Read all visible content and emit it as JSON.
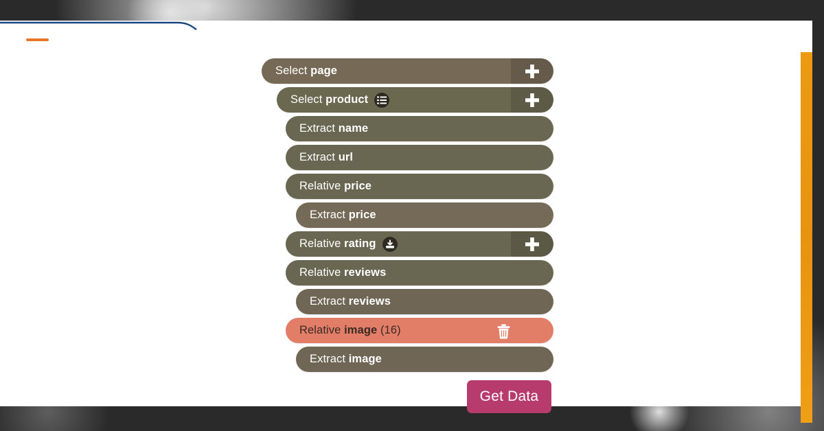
{
  "background": {
    "photo_description": "grayscale-photo-backdrop",
    "card_color": "#ffffff",
    "blue_accent": "#17477f",
    "orange_accent": "#e8752a",
    "orange_rail": "#eb9a12"
  },
  "tree": {
    "rows": [
      {
        "action": "Select",
        "target": "page",
        "count": "",
        "depth": 0,
        "color": "#766955",
        "has_plus": true,
        "badge": "",
        "has_trash": false,
        "selected": false
      },
      {
        "action": "Select",
        "target": "product",
        "count": "",
        "depth": 1,
        "color": "#6b6850",
        "has_plus": true,
        "badge": "list-icon",
        "has_trash": false,
        "selected": false
      },
      {
        "action": "Extract",
        "target": "name",
        "count": "",
        "depth": 2,
        "color": "#696751",
        "has_plus": false,
        "badge": "",
        "has_trash": false,
        "selected": false
      },
      {
        "action": "Extract",
        "target": "url",
        "count": "",
        "depth": 2,
        "color": "#696751",
        "has_plus": false,
        "badge": "",
        "has_trash": false,
        "selected": false
      },
      {
        "action": "Relative",
        "target": "price",
        "count": "",
        "depth": 2,
        "color": "#696751",
        "has_plus": false,
        "badge": "",
        "has_trash": false,
        "selected": false
      },
      {
        "action": "Extract",
        "target": "price",
        "count": "",
        "depth": 3,
        "color": "#756a58",
        "has_plus": false,
        "badge": "",
        "has_trash": false,
        "selected": false
      },
      {
        "action": "Relative",
        "target": "rating",
        "count": "",
        "depth": 2,
        "color": "#696751",
        "has_plus": true,
        "badge": "download-icon",
        "has_trash": false,
        "selected": false
      },
      {
        "action": "Relative",
        "target": "reviews",
        "count": "",
        "depth": 2,
        "color": "#696751",
        "has_plus": false,
        "badge": "",
        "has_trash": false,
        "selected": false
      },
      {
        "action": "Extract",
        "target": "reviews",
        "count": "",
        "depth": 3,
        "color": "#6f6656",
        "has_plus": false,
        "badge": "",
        "has_trash": false,
        "selected": false
      },
      {
        "action": "Relative",
        "target": "image",
        "count": "(16)",
        "depth": 2,
        "color": "#e27d68",
        "has_plus": false,
        "badge": "",
        "has_trash": true,
        "selected": true
      },
      {
        "action": "Extract",
        "target": "image",
        "count": "",
        "depth": 3,
        "color": "#6f6656",
        "has_plus": false,
        "badge": "",
        "has_trash": false,
        "selected": false
      }
    ]
  },
  "actions": {
    "get_data_label": "Get Data",
    "get_data_color": "#b83b6e",
    "add_label": "+",
    "delete_label": "delete"
  }
}
